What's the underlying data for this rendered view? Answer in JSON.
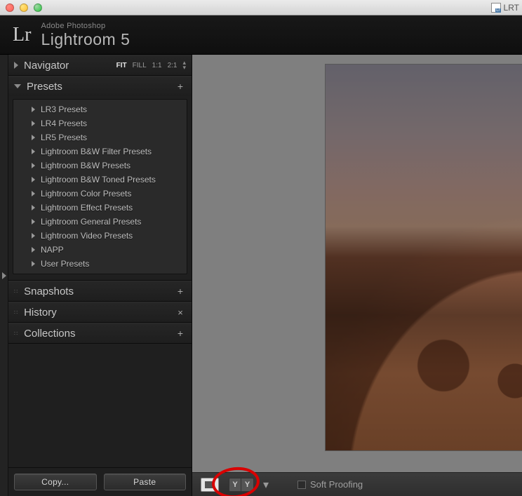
{
  "window": {
    "titleRight": "LRT"
  },
  "brand": {
    "adobe": "Adobe Photoshop",
    "product": "Lightroom 5",
    "logo": "Lr"
  },
  "navigator": {
    "title": "Navigator",
    "zooms": [
      "FIT",
      "FILL",
      "1:1",
      "2:1"
    ]
  },
  "presets": {
    "title": "Presets",
    "items": [
      "LR3 Presets",
      "LR4 Presets",
      "LR5 Presets",
      "Lightroom B&W Filter Presets",
      "Lightroom B&W Presets",
      "Lightroom B&W Toned Presets",
      "Lightroom Color Presets",
      "Lightroom Effect Presets",
      "Lightroom General Presets",
      "Lightroom Video Presets",
      "NAPP",
      "User Presets"
    ]
  },
  "snapshots": {
    "title": "Snapshots"
  },
  "history": {
    "title": "History"
  },
  "collections": {
    "title": "Collections"
  },
  "buttons": {
    "copy": "Copy...",
    "paste": "Paste"
  },
  "toolbar": {
    "compare1": "Y",
    "compare2": "Y",
    "softproof": "Soft Proofing"
  }
}
